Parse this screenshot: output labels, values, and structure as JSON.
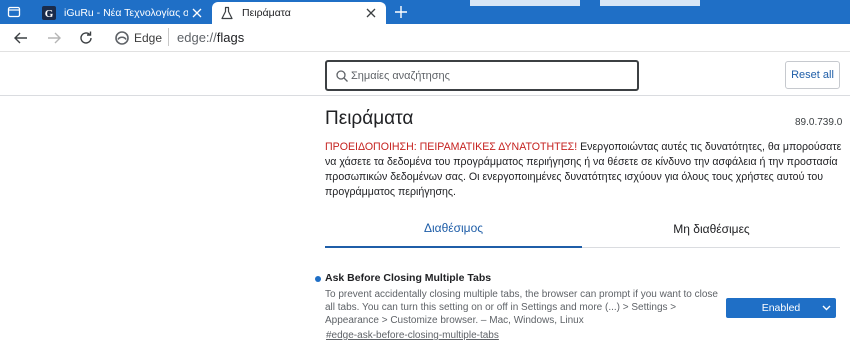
{
  "browser": {
    "tabs": [
      {
        "title": "iGuRu - Νέα Τεχνολογίας σε πρ",
        "favicon": "iguru-g-icon",
        "active": false
      },
      {
        "title": "Πειράματα",
        "favicon": "flask-icon",
        "active": true
      }
    ],
    "address": {
      "site_label": "Edge",
      "url_scheme": "edge://",
      "url_path": "flags"
    },
    "colors": {
      "tabstrip": "#1f6fc6",
      "accent": "#1f5ea8",
      "warning": "#c5221f"
    }
  },
  "header": {
    "search_placeholder": "Σημαίες αναζήτησης",
    "reset_label": "Reset all"
  },
  "page": {
    "title": "Πειράματα",
    "version": "89.0.739.0",
    "warning_label": "ΠΡΟΕΙΔΟΠΟΙΗΣΗ: ΠΕΙΡΑΜΑΤΙΚΕΣ ΔΥΝΑΤΟΤΗΤΕΣ!",
    "warning_text": " Ενεργοποιώντας αυτές τις δυνατότητες, θα μπορούσατε να χάσετε τα δεδομένα του προγράμματος περιήγησης ή να θέσετε σε κίνδυνο την ασφάλεια ή την προστασία προσωπικών δεδομένων σας. Οι ενεργοποιημένες δυνατότητες ισχύουν για όλους τους χρήστες αυτού του προγράμματος περιήγησης.",
    "tabs": [
      {
        "label": "Διαθέσιμος"
      },
      {
        "label": "Μη διαθέσιμες"
      }
    ]
  },
  "experiment": {
    "name": "Ask Before Closing Multiple Tabs",
    "description": "To prevent accidentally closing multiple tabs, the browser can prompt if you want to close all tabs. You can turn this setting on or off in Settings and more (...) > Settings > Appearance > Customize browser. – Mac, Windows, Linux",
    "link": "#edge-ask-before-closing-multiple-tabs",
    "selected_value": "Enabled"
  }
}
